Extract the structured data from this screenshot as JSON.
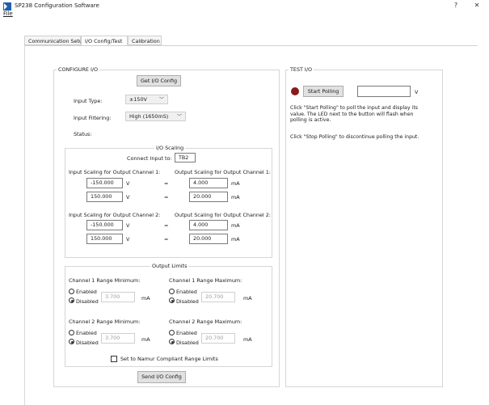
{
  "window": {
    "title": "SP238 Configuration Software",
    "help": "?",
    "close": "✕"
  },
  "menu": {
    "file": "File"
  },
  "tabs": [
    {
      "label": "Communication Setup"
    },
    {
      "label": "I/O Config/Test"
    },
    {
      "label": "Calibration"
    }
  ],
  "configure": {
    "title": "CONFIGURE I/O",
    "get_button": "Get I/O Config",
    "input_type_label": "Input Type:",
    "input_type_value": "±150V",
    "input_filtering_label": "Input Filtering:",
    "input_filtering_value": "High (1650mS)",
    "status_label": "Status:"
  },
  "scaling": {
    "title": "I/O Scaling",
    "connect_label": "Connect Input to:",
    "connect_value": "TB2",
    "ch1_input_header": "Input Scaling for Output Channel 1:",
    "ch1_output_header": "Output Scaling for Output Channel 1:",
    "ch2_input_header": "Input Scaling for Output Channel 2:",
    "ch2_output_header": "Output Scaling for Output Channel 2:",
    "v_unit": "V",
    "ma_unit": "mA",
    "equals": "=",
    "ch1_in_1": "-150.000",
    "ch1_out_1": "4.000",
    "ch1_in_2": "150.000",
    "ch1_out_2": "20.000",
    "ch2_in_1": "-150.000",
    "ch2_out_1": "4.000",
    "ch2_in_2": "150.000",
    "ch2_out_2": "20.000"
  },
  "limits": {
    "title": "Output Limits",
    "ch1_min_label": "Channel 1 Range Minimum:",
    "ch1_max_label": "Channel 1 Range Maximum:",
    "ch2_min_label": "Channel 2 Range Minimum:",
    "ch2_max_label": "Channel 2 Range Maximum:",
    "enabled": "Enabled",
    "disabled": "Disabled",
    "ma_unit": "mA",
    "ch1_min_value": "3.700",
    "ch1_max_value": "20.700",
    "ch2_min_value": "3.700",
    "ch2_max_value": "20.700",
    "namur_label": "Set to Namur Compliant Range Limits"
  },
  "send_button": "Send I/O Config",
  "test": {
    "title": "TEST I/O",
    "start_button": "Start Polling",
    "reading_value": "",
    "unit": "V",
    "instructions_1": "Click \"Start Polling\" to poll the input and display its value. The LED next to the button will flash when polling is active.",
    "instructions_2": "Click \"Stop Polling\" to discontinue polling the input.",
    "led_color": "#8b1a1a"
  }
}
